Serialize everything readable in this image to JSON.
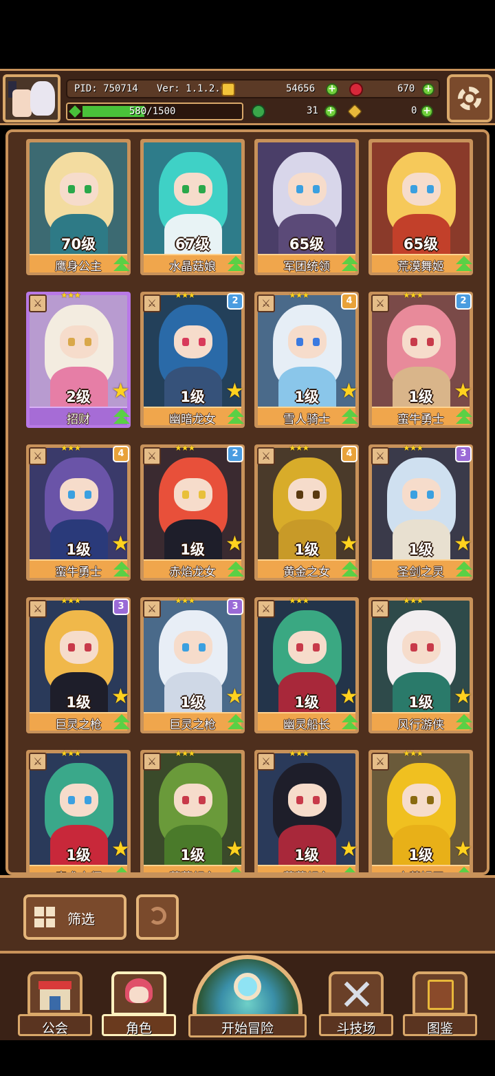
{
  "header": {
    "pid": "PID: 750714",
    "version": "Ver: 1.1.2.0",
    "gold": "54656",
    "gems": "670",
    "stamina_text": "580/1500",
    "stamina_fraction": 0.39,
    "clover": "31",
    "key": "0"
  },
  "colors": {
    "frame_gold": "#c8925a",
    "panel_brown": "#4e2f1d",
    "name_orange": "#f0a64c",
    "rare_purple": "#b879e6",
    "upgrade_green": "#5ad045",
    "star_yellow": "#ffd21f"
  },
  "heroes": [
    {
      "level": "70级",
      "name": "鹰身公主",
      "hair": "#f3dca0",
      "bg": "#3c6a72",
      "body": "#2e7a86",
      "eye": "#2aa84a",
      "rarity": "gold",
      "stars": "",
      "badge": "",
      "badge_color": ""
    },
    {
      "level": "67级",
      "name": "水晶菇娘",
      "hair": "#3fd1c6",
      "bg": "#2e7c8a",
      "body": "#e8f3f5",
      "eye": "#2aa84a",
      "rarity": "gold",
      "stars": "",
      "badge": "",
      "badge_color": ""
    },
    {
      "level": "65级",
      "name": "军团统领",
      "hair": "#d8d6ea",
      "bg": "#4a3e68",
      "body": "#5b4a78",
      "eye": "#3ba0e0",
      "rarity": "gold",
      "stars": "",
      "badge": "",
      "badge_color": ""
    },
    {
      "level": "65级",
      "name": "荒漠舞姬",
      "hair": "#f6c95a",
      "bg": "#8a3a2a",
      "body": "#c2402a",
      "eye": "#3ba0e0",
      "rarity": "gold",
      "stars": "",
      "badge": "",
      "badge_color": ""
    },
    {
      "level": "2级",
      "name": "招财",
      "hair": "#f3ece0",
      "bg": "#b89bd0",
      "body": "#e67ea6",
      "eye": "#d9a84a",
      "rarity": "purple",
      "stars": "★★★",
      "badge": "",
      "badge_color": ""
    },
    {
      "level": "1级",
      "name": "幽暗龙女",
      "hair": "#2a6aa8",
      "bg": "#23405a",
      "body": "#36527a",
      "eye": "#d83a5a",
      "rarity": "gold",
      "stars": "★★★",
      "badge": "2",
      "badge_color": "#4a9ce0"
    },
    {
      "level": "1级",
      "name": "雪人骑士",
      "hair": "#e6eef6",
      "bg": "#4a6a8a",
      "body": "#8ac6ea",
      "eye": "#3b7ae0",
      "rarity": "gold",
      "stars": "★★★",
      "badge": "4",
      "badge_color": "#e8a23a"
    },
    {
      "level": "1级",
      "name": "蛮牛勇士",
      "hair": "#e88a9a",
      "bg": "#7a4a48",
      "body": "#d9b58a",
      "eye": "#c83a4a",
      "rarity": "gold",
      "stars": "★★★",
      "badge": "2",
      "badge_color": "#4a9ce0"
    },
    {
      "level": "1级",
      "name": "蛮牛勇士",
      "hair": "#6a54a8",
      "bg": "#3a3a6a",
      "body": "#2a3a7a",
      "eye": "#3ba0e0",
      "rarity": "gold",
      "stars": "★★★",
      "badge": "4",
      "badge_color": "#e8a23a"
    },
    {
      "level": "1级",
      "name": "赤焰龙女",
      "hair": "#e8503a",
      "bg": "#3a2a30",
      "body": "#1e1e2a",
      "eye": "#e8c03a",
      "rarity": "gold",
      "stars": "★★★",
      "badge": "2",
      "badge_color": "#4a9ce0"
    },
    {
      "level": "1级",
      "name": "黄金之女",
      "hair": "#d8ac2a",
      "bg": "#4a3a2a",
      "body": "#c89a28",
      "eye": "#5a3a10",
      "rarity": "gold",
      "stars": "★★★",
      "badge": "4",
      "badge_color": "#e8a23a"
    },
    {
      "level": "1级",
      "name": "圣剑之灵",
      "hair": "#cfe0f0",
      "bg": "#3a3a4a",
      "body": "#e8e0d0",
      "eye": "#3ba0e0",
      "rarity": "gold",
      "stars": "★★★",
      "badge": "3",
      "badge_color": "#9a6ad6"
    },
    {
      "level": "1级",
      "name": "巨灵之枪",
      "hair": "#f0b84a",
      "bg": "#2a3a5a",
      "body": "#1e1e2a",
      "eye": "#c83a4a",
      "rarity": "gold",
      "stars": "★★★",
      "badge": "3",
      "badge_color": "#9a6ad6"
    },
    {
      "level": "1级",
      "name": "巨灵之枪",
      "hair": "#e8eef6",
      "bg": "#4a6a8a",
      "body": "#cfd8e6",
      "eye": "#3ba0e0",
      "rarity": "gold",
      "stars": "★★★",
      "badge": "3",
      "badge_color": "#9a6ad6"
    },
    {
      "level": "1级",
      "name": "幽灵船长",
      "hair": "#3aa882",
      "bg": "#23344a",
      "body": "#a8283a",
      "eye": "#c83a4a",
      "rarity": "gold",
      "stars": "★★★",
      "badge": "",
      "badge_color": ""
    },
    {
      "level": "1级",
      "name": "风行游侠",
      "hair": "#f2eef0",
      "bg": "#2e4a4a",
      "body": "#2a7a6a",
      "eye": "#c83a4a",
      "rarity": "gold",
      "stars": "★★★",
      "badge": "",
      "badge_color": ""
    },
    {
      "level": "1级",
      "name": "魔术大师",
      "hair": "#3aa88a",
      "bg": "#2a3a5a",
      "body": "#c8283a",
      "eye": "#3ba0e0",
      "rarity": "gold",
      "stars": "★★★",
      "badge": "",
      "badge_color": ""
    },
    {
      "level": "1级",
      "name": "蔷薇领主",
      "hair": "#6a9a3a",
      "bg": "#3a4a2a",
      "body": "#4a7a2a",
      "eye": "#c83a4a",
      "rarity": "gold",
      "stars": "★★★",
      "badge": "",
      "badge_color": ""
    },
    {
      "level": "1级",
      "name": "蔷薇领主",
      "hair": "#1e1e2a",
      "bg": "#2a3a5a",
      "body": "#a8283a",
      "eye": "#c83a4a",
      "rarity": "gold",
      "stars": "★★★",
      "badge": "",
      "badge_color": ""
    },
    {
      "level": "1级",
      "name": "史莱姆王",
      "hair": "#f0c020",
      "bg": "#6a5a3a",
      "body": "#e8b018",
      "eye": "#8a6a10",
      "rarity": "gold",
      "stars": "★★★",
      "badge": "",
      "badge_color": ""
    }
  ],
  "toolbar": {
    "filter_label": "筛选"
  },
  "nav": {
    "guild": "公会",
    "character": "角色",
    "adventure": "开始冒险",
    "arena": "斗技场",
    "codex": "图鉴"
  }
}
